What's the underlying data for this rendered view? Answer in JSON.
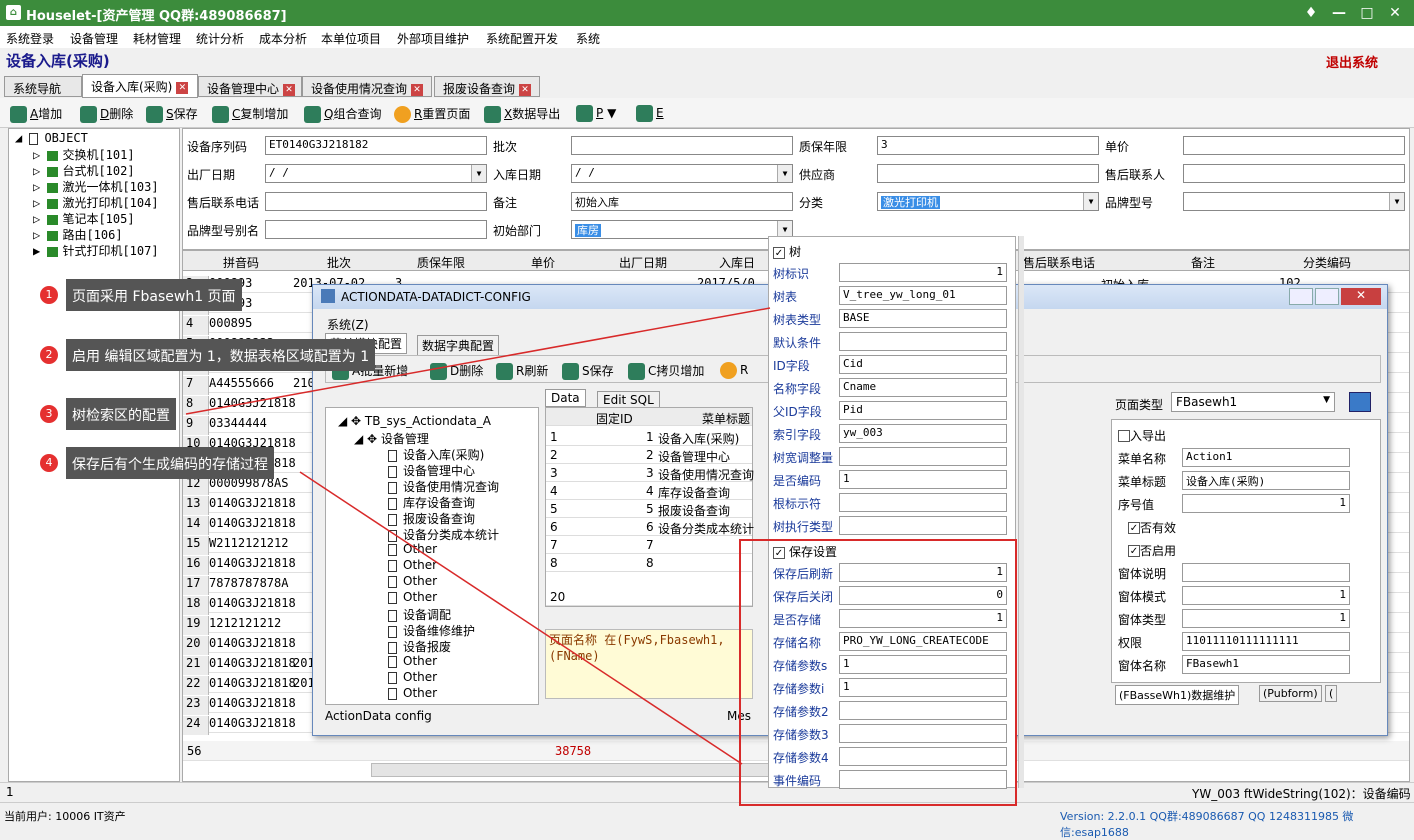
{
  "app": {
    "title": "Houselet-[资产管理 QQ群:489086687]"
  },
  "menu": [
    "系统登录",
    "设备管理",
    "耗材管理",
    "统计分析",
    "成本分析",
    "本单位项目",
    "外部项目维护",
    "系统配置开发",
    "系统"
  ],
  "page_title": "设备入库(采购)",
  "logout": "退出系统",
  "tabs": [
    {
      "label": "系统导航"
    },
    {
      "label": "设备入库(采购)"
    },
    {
      "label": "设备管理中心"
    },
    {
      "label": "设备使用情况查询"
    },
    {
      "label": "报废设备查询"
    }
  ],
  "toolbar": [
    {
      "key": "A",
      "label": "增加"
    },
    {
      "key": "D",
      "label": "删除"
    },
    {
      "key": "S",
      "label": "保存"
    },
    {
      "key": "C",
      "label": "复制增加"
    },
    {
      "key": "Q",
      "label": "组合查询"
    },
    {
      "key": "R",
      "label": "重置页面"
    },
    {
      "key": "X",
      "label": "数据导出"
    },
    {
      "key": "P",
      "label": "▼"
    },
    {
      "key": "E",
      "label": ""
    }
  ],
  "tree": {
    "root": "OBJECT",
    "items": [
      "交换机[101]",
      "台式机[102]",
      "激光一体机[103]",
      "激光打印机[104]",
      "笔记本[105]",
      "路由[106]",
      "针式打印机[107]"
    ]
  },
  "form": {
    "labels": [
      "设备序列码",
      "批次",
      "质保年限",
      "单价",
      "出厂日期",
      "入库日期",
      "供应商",
      "售后联系人",
      "售后联系电话",
      "备注",
      "分类",
      "品牌型号",
      "品牌型号别名",
      "初始部门"
    ],
    "serial": "ET0140G3J218182",
    "warranty": "3",
    "factory_date": "  /  /",
    "stock_date": "  /  /",
    "remark": "初始入库",
    "category": "激光打印机",
    "dept": "库房"
  },
  "grid": {
    "headers": [
      "拼音码",
      "批次",
      "质保年限",
      "单价",
      "出厂日期",
      "入库日",
      "售后联系电话",
      "备注",
      "分类编码"
    ],
    "rows": [
      {
        "n": "2",
        "code": "000893",
        "batch": "2013-07-02",
        "warranty": "3",
        "date": "2017/5/0",
        "remark": "初始入库",
        "cat": "102"
      },
      {
        "n": "3",
        "code": "000893",
        "batch": "",
        "warranty": "",
        "date": "",
        "remark": "",
        "cat": ""
      },
      {
        "n": "4",
        "code": "000895",
        "batch": "",
        "warranty": "",
        "date": "",
        "remark": "",
        "cat": ""
      },
      {
        "n": "5",
        "code": "000892233",
        "batch": "",
        "warranty": "",
        "date": "",
        "remark": "",
        "cat": ""
      },
      {
        "n": "6",
        "code": "0000",
        "batch": "",
        "warranty": "",
        "date": "",
        "remark": "",
        "cat": ""
      },
      {
        "n": "7",
        "code": "A44555666",
        "batch": "210",
        "warranty": "",
        "date": "",
        "remark": "",
        "cat": ""
      },
      {
        "n": "8",
        "code": "0140G3J21818",
        "batch": "",
        "warranty": "",
        "date": "",
        "remark": "",
        "cat": ""
      },
      {
        "n": "9",
        "code": "03344444",
        "batch": "",
        "warranty": "",
        "date": "",
        "remark": "",
        "cat": ""
      },
      {
        "n": "10",
        "code": "0140G3J21818",
        "batch": "",
        "warranty": "",
        "date": "",
        "remark": "",
        "cat": ""
      },
      {
        "n": "11",
        "code": "0140G3J21818",
        "batch": "",
        "warranty": "",
        "date": "",
        "remark": "",
        "cat": ""
      },
      {
        "n": "12",
        "code": "000099878AS",
        "batch": "",
        "warranty": "",
        "date": "",
        "remark": "",
        "cat": ""
      },
      {
        "n": "13",
        "code": "0140G3J21818",
        "batch": "",
        "warranty": "",
        "date": "",
        "remark": "",
        "cat": ""
      },
      {
        "n": "14",
        "code": "0140G3J21818",
        "batch": "",
        "warranty": "",
        "date": "",
        "remark": "",
        "cat": ""
      },
      {
        "n": "15",
        "code": "W2112121212",
        "batch": "",
        "warranty": "",
        "date": "",
        "remark": "",
        "cat": ""
      },
      {
        "n": "16",
        "code": "0140G3J21818",
        "batch": "",
        "warranty": "",
        "date": "",
        "remark": "",
        "cat": ""
      },
      {
        "n": "17",
        "code": "7878787878A",
        "batch": "",
        "warranty": "",
        "date": "",
        "remark": "",
        "cat": ""
      },
      {
        "n": "18",
        "code": "0140G3J21818",
        "batch": "",
        "warranty": "",
        "date": "",
        "remark": "",
        "cat": ""
      },
      {
        "n": "19",
        "code": "1212121212",
        "batch": "",
        "warranty": "",
        "date": "",
        "remark": "",
        "cat": ""
      },
      {
        "n": "20",
        "code": "0140G3J21818",
        "batch": "",
        "warranty": "",
        "date": "",
        "remark": "",
        "cat": ""
      },
      {
        "n": "21",
        "code": "0140G3J21818",
        "batch": "201",
        "warranty": "",
        "date": "",
        "remark": "",
        "cat": ""
      },
      {
        "n": "22",
        "code": "0140G3J21818",
        "batch": "201",
        "warranty": "",
        "date": "",
        "remark": "",
        "cat": ""
      },
      {
        "n": "23",
        "code": "0140G3J21818",
        "batch": "",
        "warranty": "",
        "date": "",
        "remark": "",
        "cat": ""
      },
      {
        "n": "24",
        "code": "0140G3J21818",
        "batch": "",
        "warranty": "",
        "date": "",
        "remark": "",
        "cat": ""
      }
    ],
    "footer_count": "56",
    "footer_sum": "38758",
    "extra_header": "是否"
  },
  "callouts": [
    {
      "n": "1",
      "text": "页面采用 Fbasewh1 页面"
    },
    {
      "n": "2",
      "text": "启用 编辑区域配置为 1，数据表格区域配置为 1"
    },
    {
      "n": "3",
      "text": "树检索区的配置"
    },
    {
      "n": "4",
      "text": "保存后有个生成编码的存储过程"
    }
  ],
  "dialog": {
    "title": "ACTIONDATA-DATADICT-CONFIG",
    "menu": "系统(Z)",
    "tabs": [
      "菜单模块配置",
      "数据字典配置"
    ],
    "toolbar": [
      "A批量新增",
      "D删除",
      "R刷新",
      "S保存",
      "C拷贝增加",
      "R"
    ],
    "tree_root": "TB_sys_Actiondata_A",
    "tree_group": "设备管理",
    "tree_items": [
      "设备入库(采购)",
      "设备管理中心",
      "设备使用情况查询",
      "库存设备查询",
      "报废设备查询",
      "设备分类成本统计",
      "Other",
      "Other",
      "Other",
      "Other",
      "设备调配",
      "设备维修维护",
      "设备报废",
      "Other",
      "Other",
      "Other"
    ],
    "subtabs": [
      "Data",
      "Edit SQL"
    ],
    "grid_headers": [
      "固定ID",
      "菜单标题"
    ],
    "grid_rows": [
      {
        "n": "1",
        "id": "1",
        "title": "设备入库(采购)"
      },
      {
        "n": "2",
        "id": "2",
        "title": "设备管理中心"
      },
      {
        "n": "3",
        "id": "3",
        "title": "设备使用情况查询"
      },
      {
        "n": "4",
        "id": "4",
        "title": "库存设备查询"
      },
      {
        "n": "5",
        "id": "5",
        "title": "报废设备查询"
      },
      {
        "n": "6",
        "id": "6",
        "title": "设备分类成本统计"
      },
      {
        "n": "7",
        "id": "7",
        "title": ""
      },
      {
        "n": "8",
        "id": "8",
        "title": ""
      }
    ],
    "grid_count": "20",
    "note": "页面名称 在(FywS,Fbasewh1,(FName)",
    "status_left": "ActionData  config",
    "status_mid": "Mes",
    "page_type_label": "页面类型",
    "page_type_value": "FBasewh1",
    "right_props": [
      {
        "label": "导入导出",
        "value": "",
        "chk": true,
        "checked": false
      },
      {
        "label": "菜单名称",
        "value": "Action1"
      },
      {
        "label": "菜单标题",
        "value": "设备入库(采购)"
      },
      {
        "label": "序号值",
        "value": "1",
        "right": true
      },
      {
        "label": "是否有效",
        "value": "",
        "chk": true,
        "checked": true
      },
      {
        "label": "是否启用",
        "value": "",
        "chk": true,
        "checked": true
      },
      {
        "label": "窗体说明",
        "value": ""
      },
      {
        "label": "窗体模式",
        "value": "1",
        "right": true
      },
      {
        "label": "窗体类型",
        "value": "1",
        "right": true
      },
      {
        "label": "权限",
        "value": "11011110111111111"
      },
      {
        "label": "窗体名称",
        "value": "FBasewh1"
      }
    ],
    "bottom_tabs": [
      "(FBasseWh1)数据维护",
      "(Pubform)",
      "("
    ]
  },
  "mid_panel": {
    "tree_check": "树",
    "tree_rows": [
      {
        "label": "树标识",
        "value": "1",
        "right": true
      },
      {
        "label": "树表",
        "value": "V_tree_yw_long_01"
      },
      {
        "label": "树表类型",
        "value": "BASE"
      },
      {
        "label": "默认条件",
        "value": ""
      },
      {
        "label": "ID字段",
        "value": "Cid"
      },
      {
        "label": "名称字段",
        "value": "Cname"
      },
      {
        "label": "父ID字段",
        "value": "Pid"
      },
      {
        "label": "索引字段",
        "value": "yw_003"
      },
      {
        "label": "树宽调整量",
        "value": ""
      },
      {
        "label": "是否编码",
        "value": "1"
      },
      {
        "label": "根标示符",
        "value": ""
      },
      {
        "label": "树执行类型",
        "value": ""
      }
    ],
    "save_check": "保存设置",
    "save_rows": [
      {
        "label": "保存后刷新",
        "value": "1",
        "right": true
      },
      {
        "label": "保存后关闭",
        "value": "0",
        "right": true
      },
      {
        "label": "是否存储",
        "value": "1",
        "right": true
      },
      {
        "label": "存储名称",
        "value": "PRO_YW_LONG_CREATECODE"
      },
      {
        "label": "存储参数s",
        "value": "1"
      },
      {
        "label": "存储参数i",
        "value": "1"
      },
      {
        "label": "存储参数2",
        "value": ""
      },
      {
        "label": "存储参数3",
        "value": ""
      },
      {
        "label": "存储参数4",
        "value": ""
      },
      {
        "label": "事件编码",
        "value": ""
      }
    ]
  },
  "status": {
    "left": "1",
    "right": "YW_003 ftWideString(102)：设备编码"
  },
  "bottom": {
    "user": "当前用户:  10006 IT资产",
    "version": "Version: 2.2.0.1  QQ群:489086687  QQ  1248311985 微信:esap1688"
  }
}
